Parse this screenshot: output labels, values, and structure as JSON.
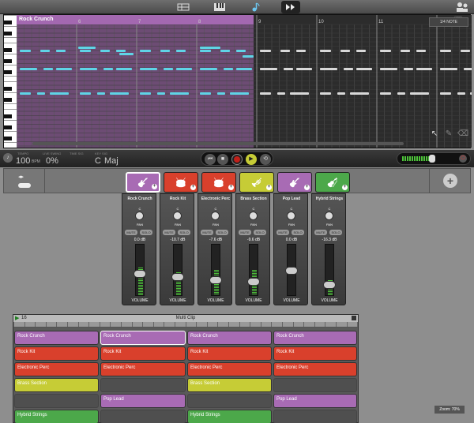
{
  "top_tabs": [
    {
      "icon": "tracks-icon",
      "active": false
    },
    {
      "icon": "piano-icon",
      "active": false
    },
    {
      "icon": "note-icon",
      "active": false
    },
    {
      "icon": "sequencer-icon",
      "active": true
    }
  ],
  "piano_roll": {
    "clip_name": "Rock Crunch",
    "ruler": [
      "5",
      "6",
      "7",
      "8",
      "9",
      "10",
      "11"
    ],
    "quantize_label": "GRID",
    "quantize_value": "1/4 NOTE"
  },
  "transport": {
    "tempo_label": "TEMPO",
    "tempo": "100",
    "tempo_unit": "BPM",
    "swing_label": "LIVE SWING",
    "swing": "0%",
    "time_sig_label": "TIME SIG",
    "key_label": "KEY SIG",
    "key": "C",
    "key_mode": "Maj"
  },
  "instruments": [
    {
      "name": "Rock Crunch",
      "color": "#a86bb4",
      "icon": "guitar-icon",
      "db": "0.0 dB",
      "level": 0.55
    },
    {
      "name": "Rock Kit",
      "color": "#d9402c",
      "icon": "drums-icon",
      "db": "-10.7 dB",
      "level": 0.45
    },
    {
      "name": "Electronic Perc",
      "color": "#d9402c",
      "icon": "drums-icon",
      "db": "-7.6 dB",
      "level": 0.5
    },
    {
      "name": "Brass Section",
      "color": "#c6cc36",
      "icon": "trumpet-icon",
      "db": "-9.6 dB",
      "level": 0.5
    },
    {
      "name": "Pop Lead",
      "color": "#a86bb4",
      "icon": "synth-icon",
      "db": "0.0 dB",
      "level": 0.0
    },
    {
      "name": "Hybrid Strings",
      "color": "#4ca84a",
      "icon": "violin-icon",
      "db": "-16.3 dB",
      "level": 0.3
    }
  ],
  "mixer_labels": {
    "pan": "PAN",
    "c": "C",
    "mute": "MUTE",
    "solo": "SOLO",
    "volume": "VOLUME"
  },
  "multiclip": {
    "title": "Multi Clip",
    "position": "16",
    "rows": [
      [
        "Rock Crunch",
        "Rock Crunch",
        "Rock Crunch",
        "Rock Crunch"
      ],
      [
        "Rock Kit",
        "Rock Kit",
        "Rock Kit",
        "Rock Kit"
      ],
      [
        "Electronic Perc",
        "Electronic Perc",
        "Electronic Perc",
        "Electronic Perc"
      ],
      [
        "Brass Section",
        "",
        "Brass Section",
        ""
      ],
      [
        "",
        "Pop Lead",
        "",
        "Pop Lead"
      ],
      [
        "Hybrid Strings",
        "",
        "Hybrid Strings",
        ""
      ]
    ],
    "row_colors": [
      "#a86bb4",
      "#d9402c",
      "#d9402c",
      "#c6cc36",
      "#a86bb4",
      "#4ca84a"
    ],
    "zoom": "Zoom: 70%"
  }
}
